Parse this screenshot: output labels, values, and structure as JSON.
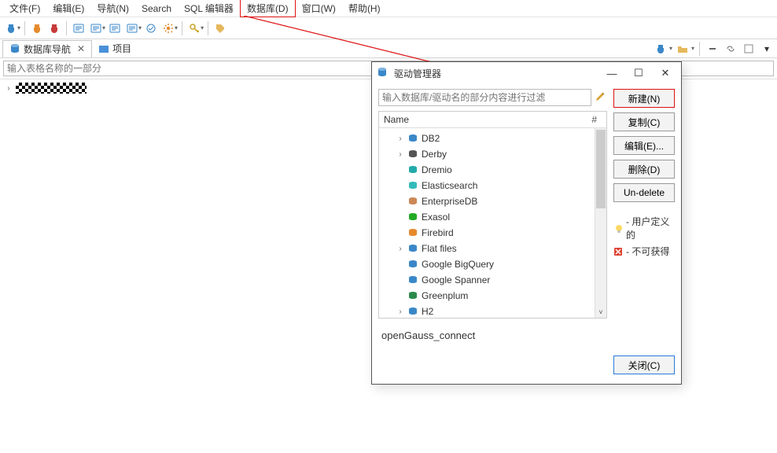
{
  "menu": {
    "file": "文件(F)",
    "edit": "编辑(E)",
    "navigate": "导航(N)",
    "search": "Search",
    "sql": "SQL 编辑器",
    "database": "数据库(D)",
    "window": "窗口(W)",
    "help": "帮助(H)"
  },
  "tabs": {
    "db_nav": "数据库导航",
    "project": "项目"
  },
  "nav": {
    "filter_placeholder": "输入表格名称的一部分"
  },
  "dialog": {
    "title": "驱动管理器",
    "filter_placeholder": "输入数据库/驱动名的部分内容进行过滤",
    "header_name": "Name",
    "header_num": "#",
    "buttons": {
      "new": "新建(N)",
      "copy": "复制(C)",
      "edit": "编辑(E)...",
      "delete": "删除(D)",
      "undelete": "Un-delete",
      "close": "关闭(C)"
    },
    "legend": {
      "user_defined": "- 用户定义的",
      "unavailable": "- 不可获得"
    },
    "status": "openGauss_connect",
    "tree": [
      {
        "label": "DB2",
        "expandable": true,
        "icon": "db2"
      },
      {
        "label": "Derby",
        "expandable": true,
        "icon": "derby"
      },
      {
        "label": "Dremio",
        "expandable": false,
        "icon": "dremio"
      },
      {
        "label": "Elasticsearch",
        "expandable": false,
        "icon": "elastic"
      },
      {
        "label": "EnterpriseDB",
        "expandable": false,
        "icon": "edb"
      },
      {
        "label": "Exasol",
        "expandable": false,
        "icon": "exasol"
      },
      {
        "label": "Firebird",
        "expandable": false,
        "icon": "firebird"
      },
      {
        "label": "Flat files",
        "expandable": true,
        "icon": "folder"
      },
      {
        "label": "Google BigQuery",
        "expandable": false,
        "icon": "gbq"
      },
      {
        "label": "Google Spanner",
        "expandable": false,
        "icon": "spanner"
      },
      {
        "label": "Greenplum",
        "expandable": false,
        "icon": "greenplum"
      },
      {
        "label": "H2",
        "expandable": true,
        "icon": "h2"
      }
    ]
  }
}
